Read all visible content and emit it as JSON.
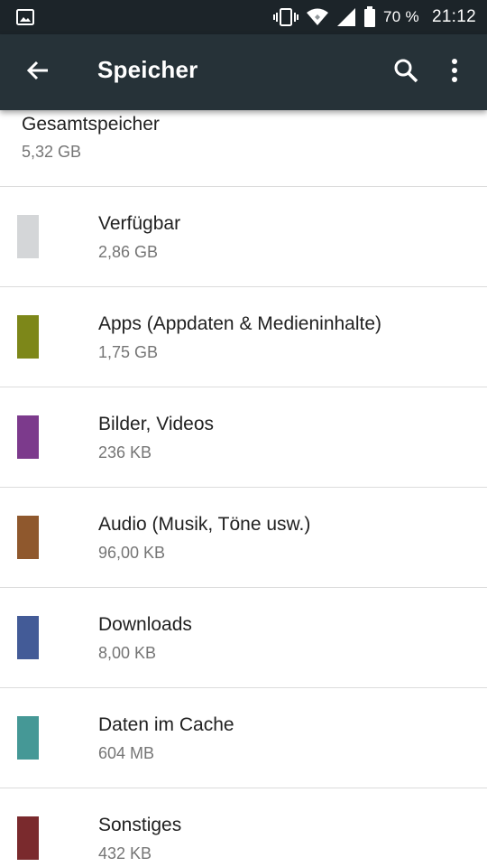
{
  "status_bar": {
    "battery_percent": "70 %",
    "time": "21:12",
    "icons": [
      "image-notification-icon",
      "vibrate-icon",
      "wifi-icon",
      "cell-signal-icon",
      "battery-icon"
    ]
  },
  "app_bar": {
    "title": "Speicher",
    "icons": [
      "back-arrow-icon",
      "search-icon",
      "more-vert-icon"
    ]
  },
  "total": {
    "title": "Gesamtspeicher",
    "value": "5,32 GB"
  },
  "items": [
    {
      "label": "Verfügbar",
      "value": "2,86 GB",
      "color": "#d4d6d8"
    },
    {
      "label": "Apps (Appdaten & Medieninhalte)",
      "value": "1,75 GB",
      "color": "#7d8719"
    },
    {
      "label": "Bilder, Videos",
      "value": "236 KB",
      "color": "#7c3a8c"
    },
    {
      "label": "Audio (Musik, Töne usw.)",
      "value": "96,00 KB",
      "color": "#8f582d"
    },
    {
      "label": "Downloads",
      "value": "8,00 KB",
      "color": "#435b97"
    },
    {
      "label": "Daten im Cache",
      "value": "604 MB",
      "color": "#459896"
    },
    {
      "label": "Sonstiges",
      "value": "432 KB",
      "color": "#7a2a2d"
    }
  ],
  "colors": {
    "status_bar": "#1c2429",
    "app_bar": "#263238"
  }
}
